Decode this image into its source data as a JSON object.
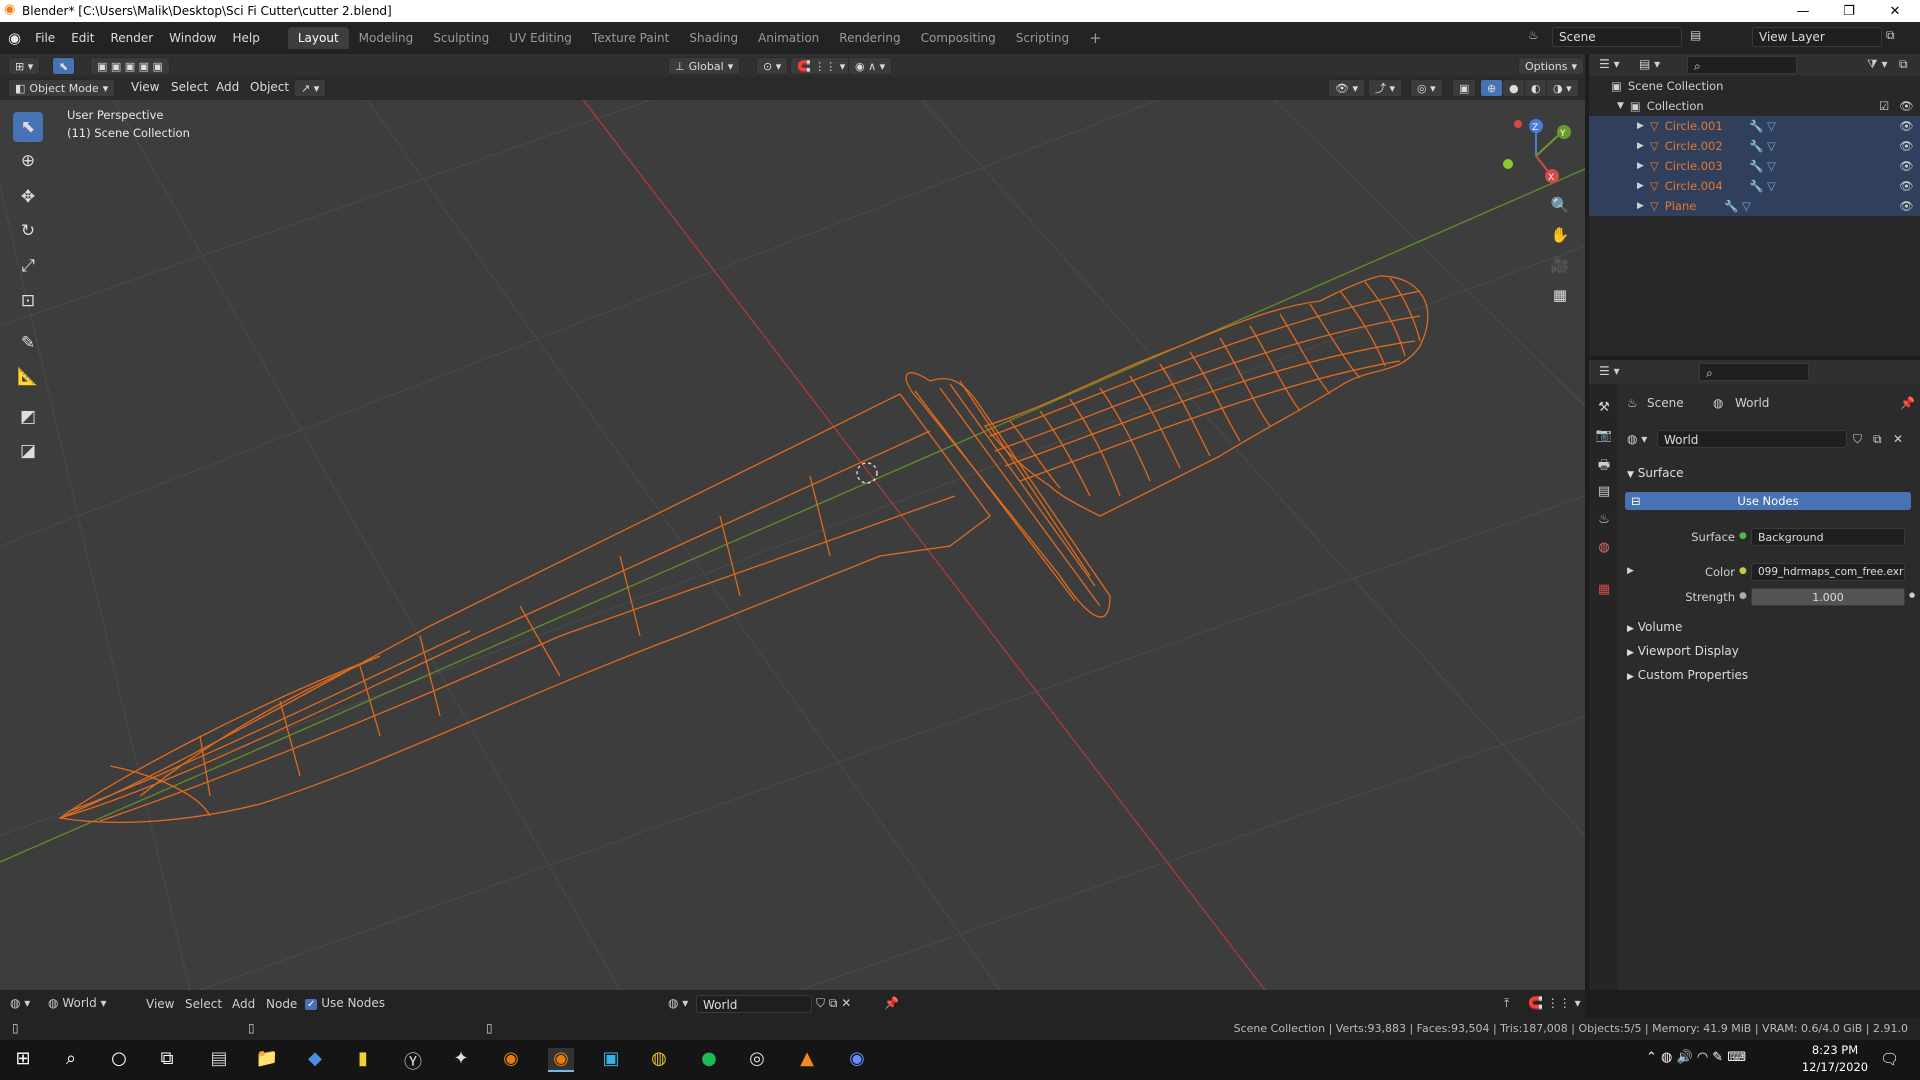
{
  "window": {
    "title": "Blender* [C:\\Users\\Malik\\Desktop\\Sci Fi Cutter\\cutter 2.blend]"
  },
  "menu": [
    "File",
    "Edit",
    "Render",
    "Window",
    "Help"
  ],
  "workspaces": [
    "Layout",
    "Modeling",
    "Sculpting",
    "UV Editing",
    "Texture Paint",
    "Shading",
    "Animation",
    "Rendering",
    "Compositing",
    "Scripting"
  ],
  "active_workspace": "Layout",
  "scene_field": "Scene",
  "view_layer_field": "View Layer",
  "viewport_header": {
    "transform": "Global",
    "options": "Options"
  },
  "viewport_header2": {
    "mode": "Object Mode",
    "items": [
      "View",
      "Select",
      "Add",
      "Object"
    ]
  },
  "viewport": {
    "perspective": "User Perspective",
    "collection": "(11) Scene Collection"
  },
  "gizmo": {
    "x": "X",
    "y": "Y",
    "z": "Z"
  },
  "outliner": {
    "scene_collection": "Scene Collection",
    "collection": "Collection",
    "objects": [
      "Circle.001",
      "Circle.002",
      "Circle.003",
      "Circle.004",
      "Plane"
    ]
  },
  "properties": {
    "breadcrumb_scene": "Scene",
    "breadcrumb_world": "World",
    "world_field": "World",
    "surface_section": "Surface",
    "use_nodes_button": "Use Nodes",
    "surface_label": "Surface",
    "surface_value": "Background",
    "color_label": "Color",
    "color_value": "099_hdrmaps_com_free.exr",
    "strength_label": "Strength",
    "strength_value": "1.000",
    "collapsed_sections": [
      "Volume",
      "Viewport Display",
      "Custom Properties"
    ]
  },
  "bottom_header": {
    "editor": "World",
    "items": [
      "View",
      "Select",
      "Add",
      "Node"
    ],
    "use_nodes": "Use Nodes",
    "world_field": "World"
  },
  "status_bar": "Scene Collection | Verts:93,883 | Faces:93,504 | Tris:187,008 | Objects:5/5 | Memory: 41.9 MiB | VRAM: 0.6/4.0 GiB | 2.91.0",
  "taskbar": {
    "time": "8:23 PM",
    "date": "12/17/2020"
  },
  "colors": {
    "accent": "#4772b3",
    "wire_selected": "#e06a1e",
    "viewport_bg": "#3d3d3d",
    "x_axis": "#b33c3c",
    "y_axis": "#6a9a2c"
  }
}
